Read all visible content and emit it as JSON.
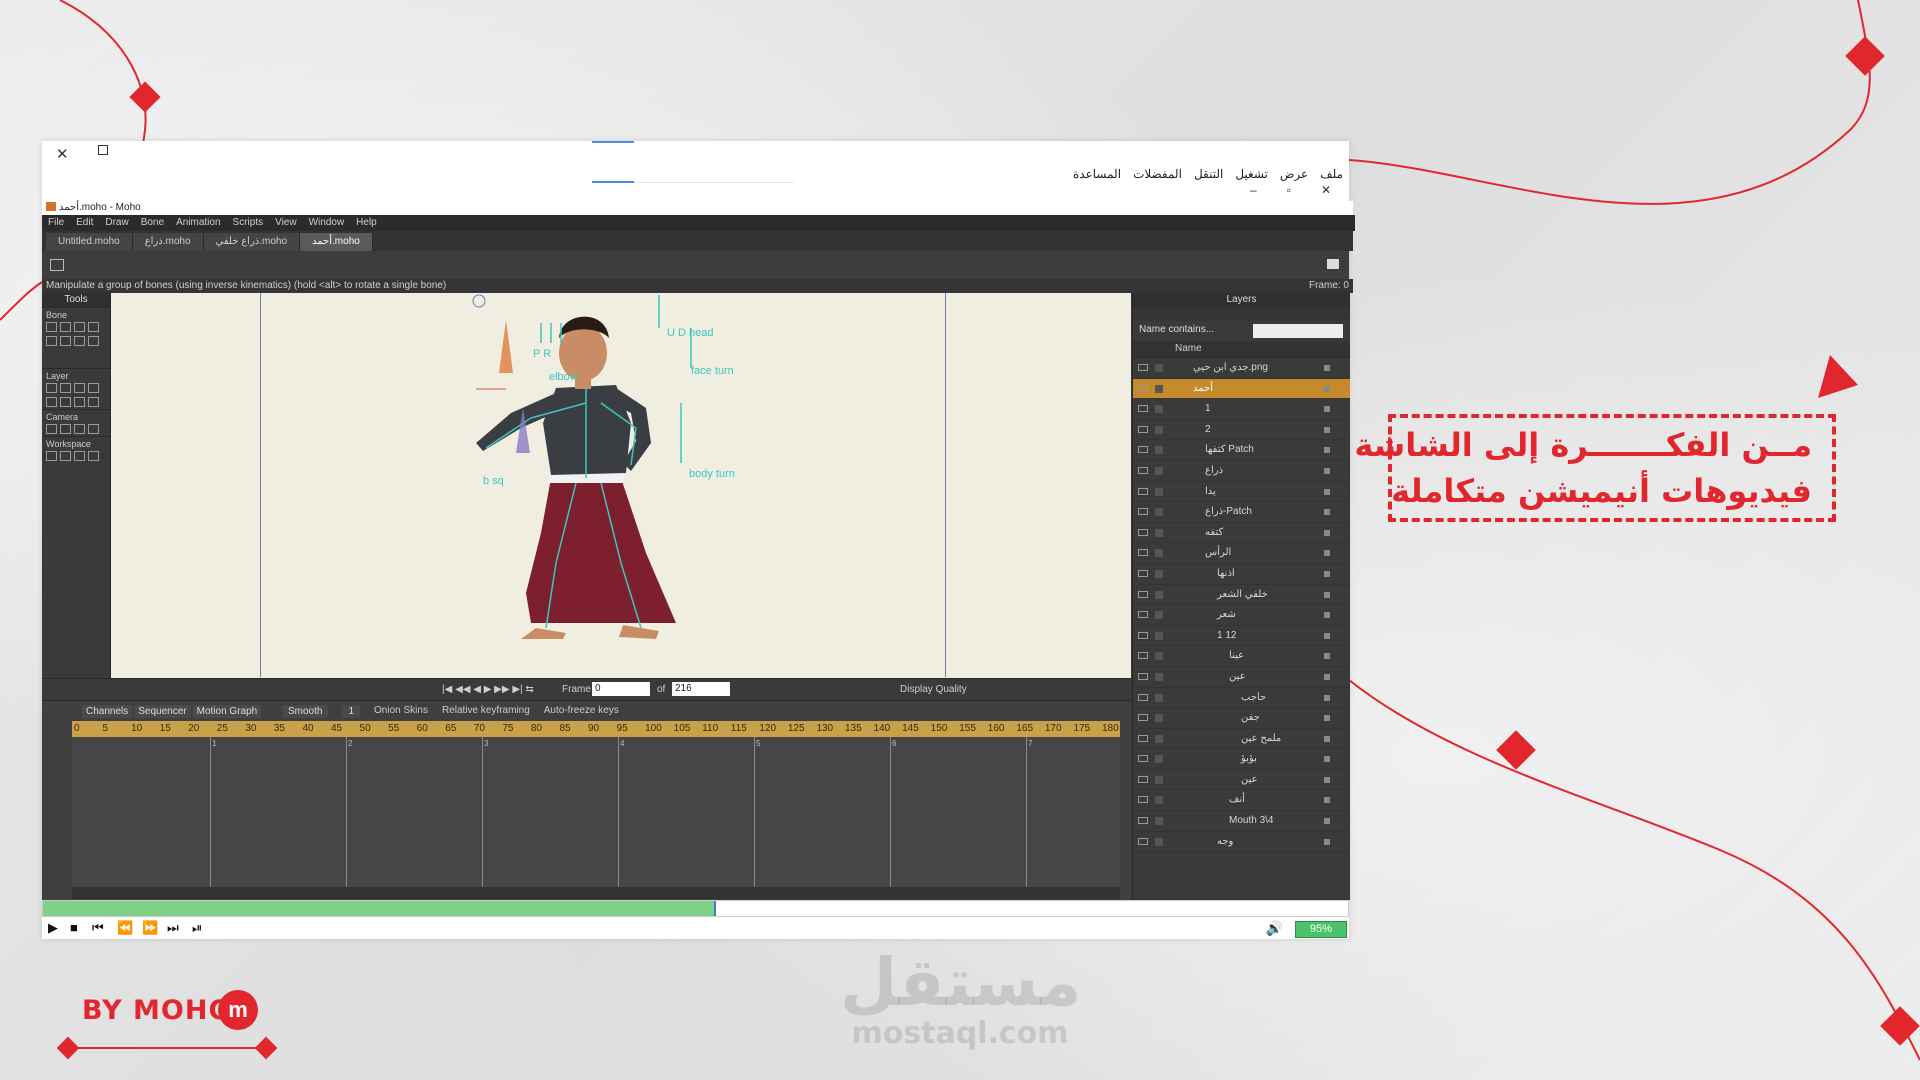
{
  "player": {
    "arabic_menu": [
      "ملف",
      "عرض",
      "تشغيل",
      "التنقل",
      "المفضلات",
      "المساعدة"
    ],
    "volume": "95%",
    "progress_fraction": 0.514
  },
  "moho": {
    "window_title": "أحمد.moho - Moho",
    "menu": [
      "File",
      "Edit",
      "Draw",
      "Bone",
      "Animation",
      "Scripts",
      "View",
      "Window",
      "Help"
    ],
    "tabs": [
      "Untitled.moho",
      "ذراع.moho",
      "ذراع خلفي.moho",
      "أحمد.moho"
    ],
    "active_tab": 3,
    "status": "Manipulate a group of bones (using inverse kinematics) (hold <alt> to rotate a single bone)",
    "frame_status": "Frame: 0",
    "tools": {
      "title": "Tools",
      "sections": [
        "Bone",
        "Layer",
        "Camera",
        "Workspace"
      ]
    },
    "bone_labels": {
      "ud_head": "U D head",
      "face_turn": "face turn",
      "body_turn": "body turn",
      "b_sq": "b sq",
      "pr": "P R",
      "elbow": "elbow"
    },
    "playbar": {
      "frame_label": "Frame",
      "frame_value": "0",
      "of_label": "of",
      "total": "216",
      "quality_label": "Display Quality"
    },
    "timeline": {
      "tabs": [
        "Channels",
        "Sequencer",
        "Motion Graph"
      ],
      "interp": "Smooth",
      "interp_num": "1",
      "onion": "Onion Skins",
      "relative": "Relative keyframing",
      "autofreeze": "Auto-freeze keys",
      "ticks": [
        "0",
        "5",
        "10",
        "15",
        "20",
        "25",
        "30",
        "35",
        "40",
        "45",
        "50",
        "55",
        "60",
        "65",
        "70",
        "75",
        "80",
        "85",
        "90",
        "95",
        "100",
        "105",
        "110",
        "115",
        "120",
        "125",
        "130",
        "135",
        "140",
        "145",
        "150",
        "155",
        "160",
        "165",
        "170",
        "175",
        "180"
      ],
      "sub_ticks": [
        "1",
        "2",
        "3",
        "4",
        "5",
        "6",
        "7"
      ]
    },
    "layers": {
      "title": "Layers",
      "filter": "Name contains...",
      "name_col": "Name",
      "rows": [
        {
          "name": "جدي ابن حيي.png",
          "indent": 0,
          "selected": false
        },
        {
          "name": "أحمد",
          "indent": 0,
          "selected": true
        },
        {
          "name": "1",
          "indent": 1,
          "selected": false
        },
        {
          "name": "2",
          "indent": 1,
          "selected": false
        },
        {
          "name": "كتفها Patch",
          "indent": 1,
          "selected": false
        },
        {
          "name": "ذراع",
          "indent": 1,
          "selected": false
        },
        {
          "name": "يدا",
          "indent": 1,
          "selected": false
        },
        {
          "name": "ذراع-Patch",
          "indent": 1,
          "selected": false
        },
        {
          "name": "كتفه",
          "indent": 1,
          "selected": false
        },
        {
          "name": "الرأس",
          "indent": 1,
          "selected": false
        },
        {
          "name": "اذنها",
          "indent": 2,
          "selected": false
        },
        {
          "name": "خلفي الشعر",
          "indent": 2,
          "selected": false
        },
        {
          "name": "شعر",
          "indent": 2,
          "selected": false
        },
        {
          "name": "1 12",
          "indent": 2,
          "selected": false
        },
        {
          "name": "عينا",
          "indent": 3,
          "selected": false
        },
        {
          "name": "عين",
          "indent": 3,
          "selected": false
        },
        {
          "name": "حاجب",
          "indent": 4,
          "selected": false
        },
        {
          "name": "جفن",
          "indent": 4,
          "selected": false
        },
        {
          "name": "ملمح عين",
          "indent": 4,
          "selected": false
        },
        {
          "name": "بؤبؤ",
          "indent": 4,
          "selected": false
        },
        {
          "name": "عين",
          "indent": 4,
          "selected": false
        },
        {
          "name": "أنف",
          "indent": 3,
          "selected": false
        },
        {
          "name": "Mouth 3\\4",
          "indent": 3,
          "selected": false
        },
        {
          "name": "وجه",
          "indent": 2,
          "selected": false
        }
      ]
    }
  },
  "promo": {
    "line1": "مــن الفكـــــــرة إلى الشاشة",
    "line2": "فيديوهات أنيميشن متكاملة"
  },
  "brand": {
    "byline": "BY MOHO",
    "badge": "m",
    "watermark_ar": "مستقل",
    "watermark_en": "mostaql.com"
  },
  "colors": {
    "accent_red": "#e1262d",
    "layer_selected": "#c58a2a",
    "ruler": "#c9a14a",
    "progress_green": "#7fd18a"
  }
}
